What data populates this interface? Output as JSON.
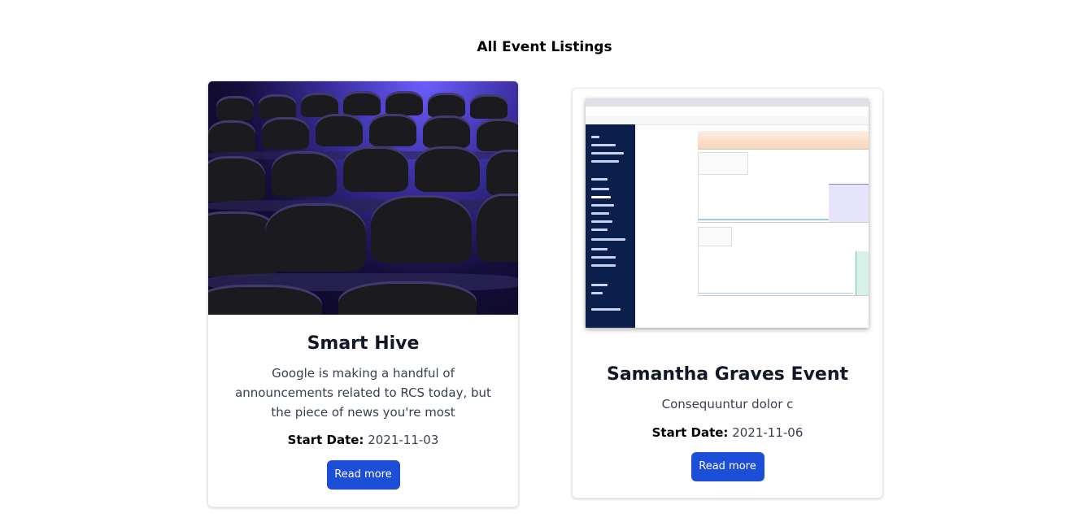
{
  "page": {
    "title": "All Event Listings"
  },
  "events": [
    {
      "title": "Smart Hive",
      "description": "Google is making a handful of announcements related to RCS today, but the piece of news you're most",
      "start_date_label": "Start Date:",
      "start_date": "2021-11-03",
      "button_label": "Read more",
      "image": "auditorium-chairs-photo"
    },
    {
      "title": "Samantha Graves Event",
      "description": "Consequuntur dolor c",
      "start_date_label": "Start Date:",
      "start_date": "2021-11-06",
      "button_label": "Read more",
      "image": "dashboard-screenshot"
    }
  ],
  "colors": {
    "button_bg": "#1d4ed8",
    "button_text": "#ffffff",
    "title_text": "#111827"
  }
}
